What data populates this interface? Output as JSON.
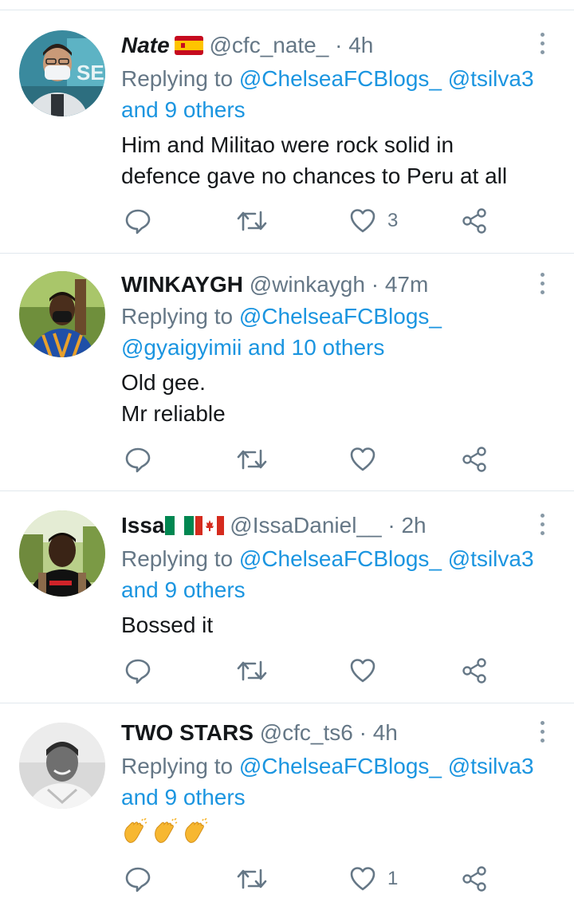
{
  "colors": {
    "link": "#1b95e0",
    "secondary_text": "#657786",
    "icon": "#657786",
    "divider": "#e1e8ed"
  },
  "tweets": [
    {
      "name": "Nate",
      "flags": [
        "spain-flag-icon"
      ],
      "handle": "@cfc_nate_",
      "dot": "·",
      "time": "4h",
      "replying_prefix": "Replying to",
      "mentions": [
        "@ChelseaFCBlogs_",
        "@tsilva3"
      ],
      "others": "and 9 others",
      "text_lines": [
        "Him and Militao were rock solid in",
        "defence gave no chances to Peru at all"
      ],
      "like_count": "3"
    },
    {
      "name": "WINKAYGH",
      "flags": [],
      "handle": "@winkaygh",
      "dot": "·",
      "time": "47m",
      "replying_prefix": "Replying to",
      "mentions": [
        "@ChelseaFCBlogs_",
        "@gyaigyimii"
      ],
      "others": "and 10 others",
      "text_lines": [
        "Old gee.",
        "Mr reliable"
      ],
      "like_count": ""
    },
    {
      "name": "Issa",
      "flags": [
        "nigeria-flag-icon",
        "canada-flag-icon"
      ],
      "handle": "@IssaDaniel__",
      "dot": "·",
      "time": "2h",
      "replying_prefix": "Replying to",
      "mentions": [
        "@ChelseaFCBlogs_",
        "@tsilva3"
      ],
      "others": "and 9 others",
      "text_lines": [
        "Bossed it"
      ],
      "like_count": ""
    },
    {
      "name": "TWO STARS",
      "flags": [],
      "handle": "@cfc_ts6",
      "dot": "·",
      "time": "4h",
      "replying_prefix": "Replying to",
      "mentions": [
        "@ChelseaFCBlogs_",
        "@tsilva3"
      ],
      "others": "and 9 others",
      "text_lines": [
        "👏👏👏"
      ],
      "like_count": "1"
    }
  ]
}
